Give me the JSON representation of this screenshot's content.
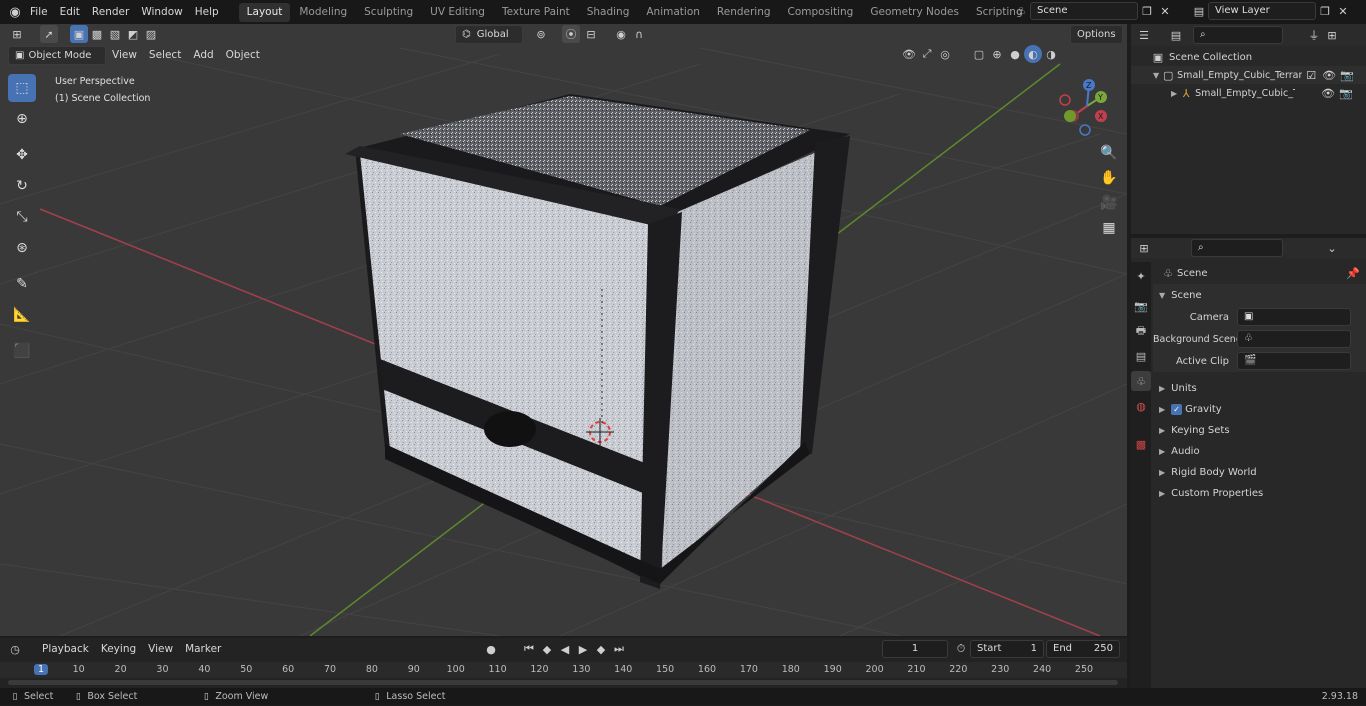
{
  "app": {
    "menu": [
      "File",
      "Edit",
      "Render",
      "Window",
      "Help"
    ]
  },
  "workspaces": [
    "Layout",
    "Modeling",
    "Sculpting",
    "UV Editing",
    "Texture Paint",
    "Shading",
    "Animation",
    "Rendering",
    "Compositing",
    "Geometry Nodes",
    "Scripting"
  ],
  "active_workspace": "Layout",
  "scene_field": "Scene",
  "view_layer_field": "View Layer",
  "toolbar_top": {
    "orientation": "Global",
    "options": "Options"
  },
  "viewport_header": {
    "mode": "Object Mode",
    "menus": [
      "View",
      "Select",
      "Add",
      "Object"
    ]
  },
  "viewport": {
    "perspective": "User Perspective",
    "collection": "(1) Scene Collection"
  },
  "gizmo": {
    "x": "X",
    "y": "Y",
    "z": "Z"
  },
  "outliner": {
    "root": "Scene Collection",
    "items": [
      {
        "label": "Small_Empty_Cubic_Terrarium"
      },
      {
        "label": "Small_Empty_Cubic_Terra"
      }
    ]
  },
  "properties": {
    "header": "Scene",
    "panel": "Scene",
    "fields": [
      {
        "label": "Camera",
        "value": ""
      },
      {
        "label": "Background Scene",
        "value": ""
      },
      {
        "label": "Active Clip",
        "value": ""
      }
    ],
    "sections": [
      "Units",
      "Gravity",
      "Keying Sets",
      "Audio",
      "Rigid Body World",
      "Custom Properties"
    ]
  },
  "timeline": {
    "menus": [
      "Playback",
      "Keying",
      "View",
      "Marker"
    ],
    "current_frame": "1",
    "start_label": "Start",
    "start": "1",
    "end_label": "End",
    "end": "250",
    "ruler": [
      "1",
      "10",
      "20",
      "30",
      "40",
      "50",
      "60",
      "70",
      "80",
      "90",
      "100",
      "110",
      "120",
      "130",
      "140",
      "150",
      "160",
      "170",
      "180",
      "190",
      "200",
      "210",
      "220",
      "230",
      "240",
      "250"
    ]
  },
  "statusbar": {
    "items": [
      "Select",
      "Box Select",
      "Zoom View",
      "Lasso Select"
    ],
    "version": "2.93.18"
  },
  "colors": {
    "accent": "#4772b3",
    "active_tab": "#303030",
    "x_axis": "#d9485a",
    "y_axis": "#7aa63c"
  }
}
